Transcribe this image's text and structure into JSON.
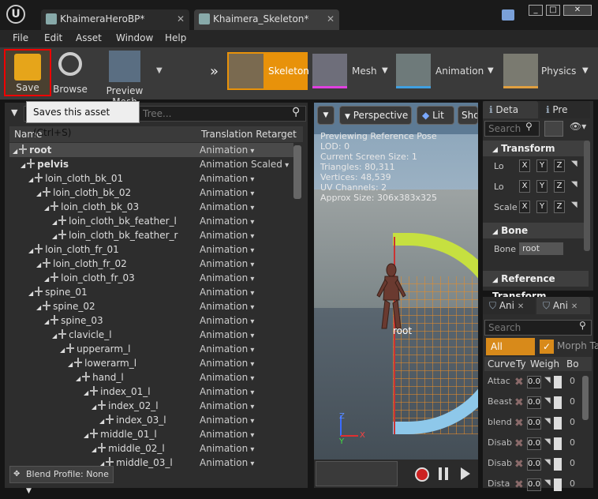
{
  "tabs": [
    {
      "label": "KhaimeraHeroBP*"
    },
    {
      "label": "Khaimera_Skeleton*"
    }
  ],
  "window_buttons": {
    "minimize": "_",
    "maximize": "□",
    "close": "✕"
  },
  "menu": [
    "File",
    "Edit",
    "Asset",
    "Window",
    "Help"
  ],
  "toolbar": {
    "save": "Save",
    "browse": "Browse",
    "preview_mesh": "Preview Mesh",
    "modes": [
      "Skeleton",
      "Mesh",
      "Animation",
      "Physics"
    ],
    "tooltip": "Saves this asset (Ctrl+S)"
  },
  "skeleton_tree": {
    "search_placeholder": "Tree...",
    "columns": [
      "Name",
      "Translation Retarget"
    ],
    "rows": [
      {
        "name": "root",
        "depth": 0,
        "retarget": "Animation"
      },
      {
        "name": "pelvis",
        "depth": 1,
        "retarget": "Animation Scaled"
      },
      {
        "name": "loin_cloth_bk_01",
        "depth": 2,
        "retarget": "Animation"
      },
      {
        "name": "loin_cloth_bk_02",
        "depth": 3,
        "retarget": "Animation"
      },
      {
        "name": "loin_cloth_bk_03",
        "depth": 4,
        "retarget": "Animation"
      },
      {
        "name": "loin_cloth_bk_feather_l",
        "depth": 5,
        "retarget": "Animation"
      },
      {
        "name": "loin_cloth_bk_feather_r",
        "depth": 5,
        "retarget": "Animation"
      },
      {
        "name": "loin_cloth_fr_01",
        "depth": 2,
        "retarget": "Animation"
      },
      {
        "name": "loin_cloth_fr_02",
        "depth": 3,
        "retarget": "Animation"
      },
      {
        "name": "loin_cloth_fr_03",
        "depth": 4,
        "retarget": "Animation"
      },
      {
        "name": "spine_01",
        "depth": 2,
        "retarget": "Animation"
      },
      {
        "name": "spine_02",
        "depth": 3,
        "retarget": "Animation"
      },
      {
        "name": "spine_03",
        "depth": 4,
        "retarget": "Animation"
      },
      {
        "name": "clavicle_l",
        "depth": 5,
        "retarget": "Animation"
      },
      {
        "name": "upperarm_l",
        "depth": 6,
        "retarget": "Animation"
      },
      {
        "name": "lowerarm_l",
        "depth": 7,
        "retarget": "Animation"
      },
      {
        "name": "hand_l",
        "depth": 8,
        "retarget": "Animation"
      },
      {
        "name": "index_01_l",
        "depth": 9,
        "retarget": "Animation"
      },
      {
        "name": "index_02_l",
        "depth": 10,
        "retarget": "Animation"
      },
      {
        "name": "index_03_l",
        "depth": 11,
        "retarget": "Animation"
      },
      {
        "name": "middle_01_l",
        "depth": 9,
        "retarget": "Animation"
      },
      {
        "name": "middle_02_l",
        "depth": 10,
        "retarget": "Animation"
      },
      {
        "name": "middle_03_l",
        "depth": 11,
        "retarget": "Animation"
      }
    ],
    "blend_profile": "Blend Profile: None"
  },
  "viewport": {
    "perspective": "Perspective",
    "lit": "Lit",
    "show": "Sho",
    "stats": [
      "Previewing Reference Pose",
      "LOD: 0",
      "Current Screen Size: 1",
      "Triangles: 80,311",
      "Vertices: 48,539",
      "UV Channels: 2",
      "Approx Size: 306x383x325"
    ],
    "bone_label": "root",
    "axis": {
      "z": "Z",
      "y": "Y",
      "x": "X"
    }
  },
  "details": {
    "tab1": "Deta",
    "tab2": "Pre",
    "search_placeholder": "Search",
    "transform": "Transform",
    "loc1": "Lo",
    "loc2": "Lo",
    "scale": "Scale",
    "x": "X",
    "y": "Y",
    "z": "Z",
    "bone_section": "Bone",
    "bone_label": "Bone",
    "bone_value": "root",
    "ref_transform": "Reference Transform"
  },
  "curves": {
    "tab1": "Ani",
    "tab2": "Ani",
    "search_placeholder": "Search",
    "all_curves": "All Curves",
    "morph": "Morph Ta",
    "headers": [
      "Curve",
      "Ty",
      "Weigh",
      "Bo"
    ],
    "rows": [
      {
        "name": "Attac",
        "weight": "0.0",
        "bone": "0"
      },
      {
        "name": "Beast",
        "weight": "0.0",
        "bone": "0"
      },
      {
        "name": "blend",
        "weight": "0.0",
        "bone": "0"
      },
      {
        "name": "Disab",
        "weight": "0.0",
        "bone": "0"
      },
      {
        "name": "Disab",
        "weight": "0.0",
        "bone": "0"
      },
      {
        "name": "Dista",
        "weight": "0.0",
        "bone": "0"
      }
    ]
  },
  "colors": {
    "accent": "#d88a1a",
    "highlight_border": "#e00000",
    "selected_row": "#4a4a4a"
  }
}
